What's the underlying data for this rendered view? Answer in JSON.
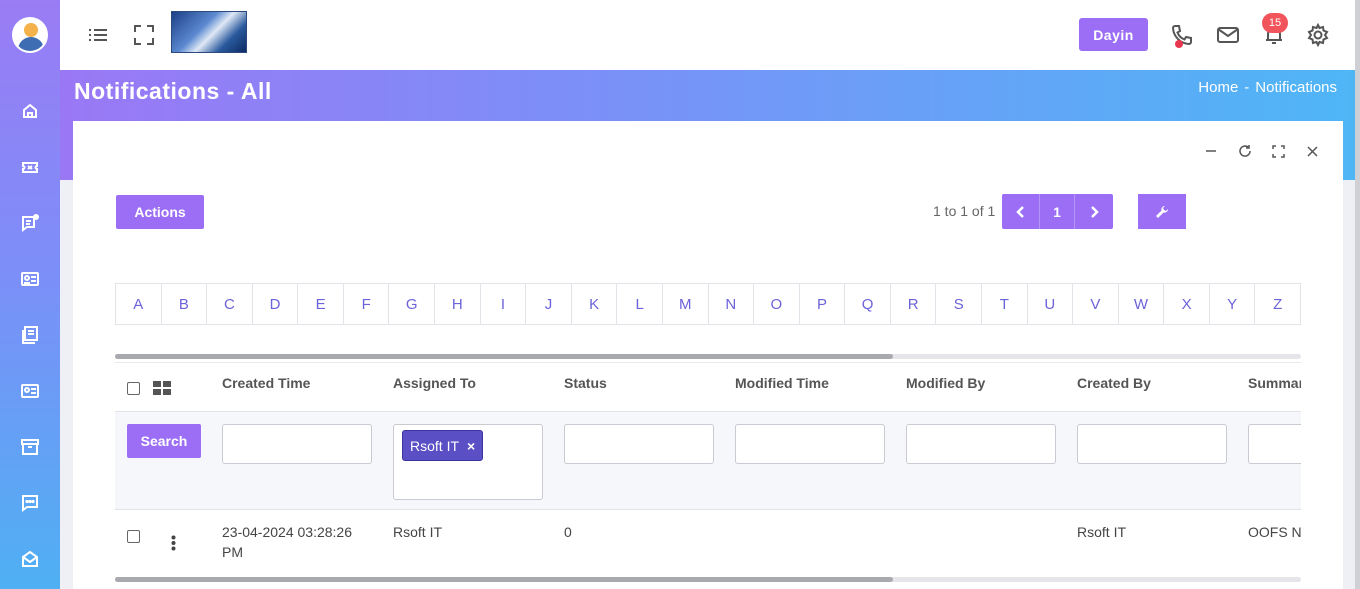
{
  "topbar": {
    "user_button": "Dayin",
    "notification_count": "15",
    "icons": [
      "menu-icon",
      "fullscreen-icon",
      "search-icon",
      "phone-icon",
      "mail-icon",
      "bell-icon",
      "gear-icon"
    ]
  },
  "sidebar": {
    "items": [
      "home-icon",
      "ticket-icon",
      "chat-list-icon",
      "contact-card-icon",
      "documents-icon",
      "id-card-icon",
      "archive-icon",
      "message-icon",
      "mail-open-icon"
    ]
  },
  "header": {
    "title": "Notifications - All",
    "breadcrumb": [
      "Home",
      "-",
      "Notifications"
    ]
  },
  "toolbar": {
    "actions_label": "Actions",
    "pager_text": "1 to 1 of 1",
    "current_page": "1"
  },
  "alphabet": [
    "A",
    "B",
    "C",
    "D",
    "E",
    "F",
    "G",
    "H",
    "I",
    "J",
    "K",
    "L",
    "M",
    "N",
    "O",
    "P",
    "Q",
    "R",
    "S",
    "T",
    "U",
    "V",
    "W",
    "X",
    "Y",
    "Z"
  ],
  "table": {
    "columns": [
      "Created Time",
      "Assigned To",
      "Status",
      "Modified Time",
      "Modified By",
      "Created By",
      "Summary"
    ],
    "search_label": "Search",
    "assigned_filter_tag": "Rsoft IT",
    "tag_remove": "×",
    "rows": [
      {
        "created_time_line1": "23-04-2024 03:28:26",
        "created_time_line2": "PM",
        "assigned_to": "Rsoft IT",
        "status": "0",
        "modified_time": "",
        "modified_by": "",
        "created_by": "Rsoft IT",
        "summary": "OOFS N"
      }
    ]
  },
  "colors": {
    "accent": "#9b6ef5",
    "tag": "#5a4fc4",
    "badge": "#f2545b",
    "letter": "#6b63d9"
  }
}
